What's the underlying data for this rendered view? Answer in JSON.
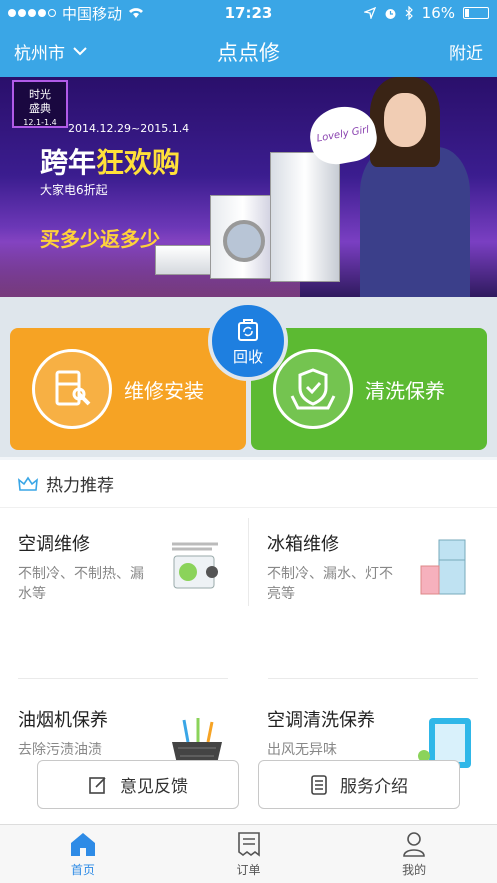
{
  "status_bar": {
    "carrier": "中国移动",
    "time": "17:23",
    "battery": "16%",
    "battery_level": 0.16
  },
  "nav": {
    "city": "杭州市",
    "title": "点点修",
    "nearby": "附近"
  },
  "banner": {
    "badge_line1": "时光",
    "badge_line2": "盛典",
    "badge_line3": "12.1-1.4",
    "date_range": "2014.12.29~2015.1.4",
    "headline_a": "跨年",
    "headline_b": "狂欢购",
    "sub": "大家电6折起",
    "slogan": "买多少返多少",
    "heart_text": "Lovely Girl"
  },
  "services": {
    "repair": "维修安装",
    "recycle": "回收",
    "clean": "清洗保养"
  },
  "hot": {
    "title": "热力推荐",
    "items": [
      {
        "name": "空调维修",
        "desc": "不制冷、不制热、漏水等"
      },
      {
        "name": "冰箱维修",
        "desc": "不制冷、漏水、灯不亮等"
      },
      {
        "name": "油烟机保养",
        "desc": "去除污渍油渍"
      },
      {
        "name": "空调清洗保养",
        "desc": "出风无异味"
      }
    ]
  },
  "buttons": {
    "feedback": "意见反馈",
    "intro": "服务介绍"
  },
  "tabs": [
    {
      "label": "首页"
    },
    {
      "label": "订单"
    },
    {
      "label": "我的"
    }
  ],
  "colors": {
    "primary": "#3aa6e6",
    "repair": "#f6a324",
    "clean": "#5cba32",
    "recycle": "#1e7fe0"
  }
}
